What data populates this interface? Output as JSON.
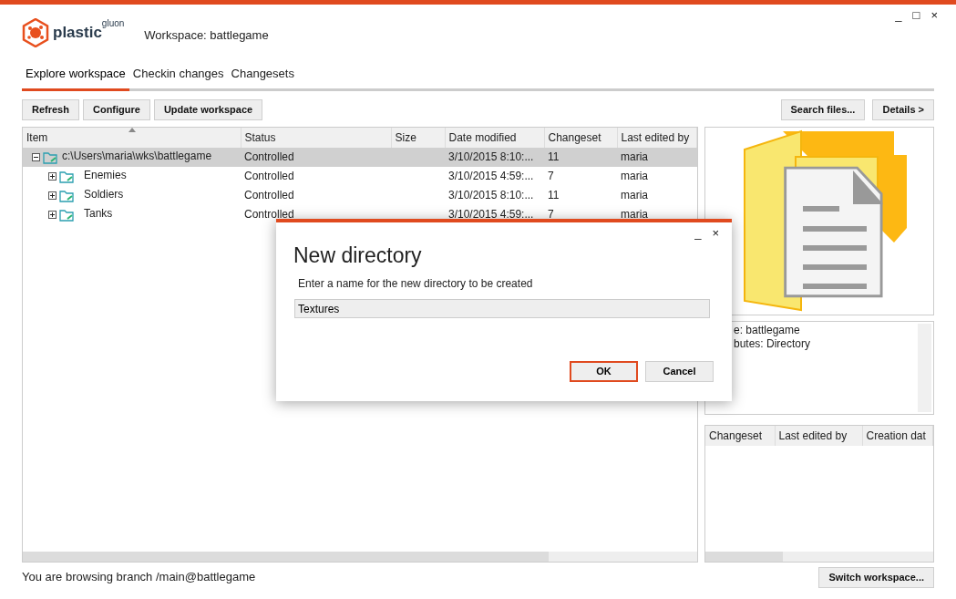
{
  "window": {
    "controls": [
      "_",
      "□",
      "×"
    ]
  },
  "logo": {
    "name": "plastic",
    "suffix": "gluon"
  },
  "workspace_title": "Workspace: battlegame",
  "tabs": [
    {
      "label": "Explore workspace",
      "selected": true
    },
    {
      "label": "Checkin changes",
      "selected": false
    },
    {
      "label": "Changesets",
      "selected": false
    }
  ],
  "toolbar": {
    "left": [
      "Refresh",
      "Configure",
      "Update workspace"
    ],
    "right": [
      "Search files...",
      "Details >"
    ]
  },
  "table": {
    "columns": [
      "Item",
      "Status",
      "Size",
      "Date modified",
      "Changeset",
      "Last edited by"
    ],
    "rows": [
      {
        "name": "c:\\Users\\maria\\wks\\battlegame",
        "status": "Controlled",
        "size": "",
        "date": "3/10/2015 8:10:...",
        "changeset": "11",
        "user": "maria",
        "expanded": true,
        "selected": true,
        "children": [
          {
            "name": "Enemies",
            "status": "Controlled",
            "date": "3/10/2015 4:59:...",
            "changeset": "7",
            "user": "maria",
            "expanded": false,
            "selected": false
          },
          {
            "name": "Soldiers",
            "status": "Controlled",
            "date": "3/10/2015 8:10:...",
            "changeset": "11",
            "user": "maria",
            "expanded": false,
            "selected": false
          },
          {
            "name": "Tanks",
            "status": "Controlled",
            "date": "3/10/2015 4:59:...",
            "changeset": "7",
            "user": "maria",
            "expanded": false,
            "selected": false
          }
        ]
      }
    ]
  },
  "info": {
    "lines": [
      "e: battlegame",
      "butes: Directory"
    ]
  },
  "history": {
    "columns": [
      "Changeset",
      "Last edited by",
      "Creation dat"
    ]
  },
  "status_bar": "You are browsing branch /main@battlegame",
  "switch_button": "Switch workspace...",
  "dialog": {
    "controls": [
      "_",
      "×"
    ],
    "title": "New directory",
    "prompt": "Enter a name for the new directory to be created",
    "value": "Textures",
    "buttons": [
      {
        "label": "OK",
        "default": true
      },
      {
        "label": "Cancel",
        "default": false
      }
    ]
  }
}
